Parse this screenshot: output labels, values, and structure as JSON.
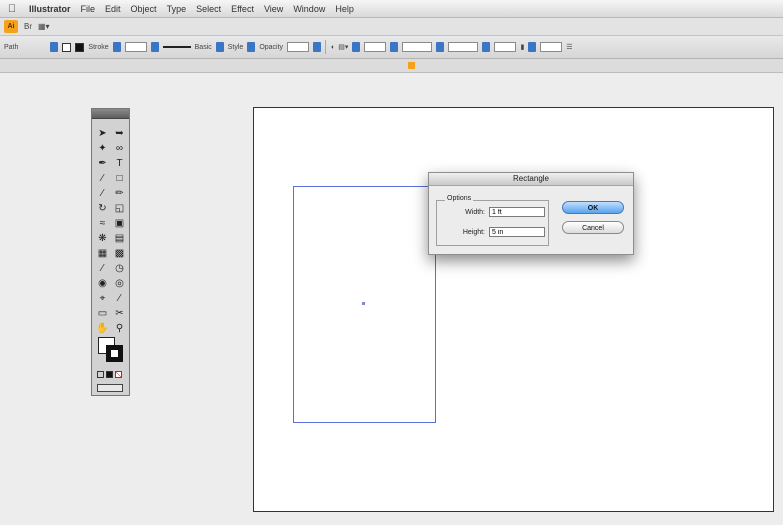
{
  "menubar": {
    "apple_icon": "apple-icon",
    "items": [
      "Illustrator",
      "File",
      "Edit",
      "Object",
      "Type",
      "Select",
      "Effect",
      "View",
      "Window",
      "Help"
    ]
  },
  "appbar": {
    "logo": "Ai"
  },
  "controlbar": {
    "path_label": "Path",
    "stroke_label": "Stroke",
    "basic_label": "Basic",
    "style_label": "Style",
    "opacity_label": "Opacity"
  },
  "document": {
    "zoom": "",
    "title": ""
  },
  "dialog": {
    "title": "Rectangle",
    "options_label": "Options",
    "width_label": "Width:",
    "width_value": "1 ft",
    "height_label": "Height:",
    "height_value": "5 in",
    "ok_label": "OK",
    "cancel_label": "Cancel"
  },
  "tools": [
    "selection-tool",
    "direct-selection-tool",
    "magic-wand-tool",
    "lasso-tool",
    "pen-tool",
    "type-tool",
    "line-tool",
    "rectangle-tool",
    "paintbrush-tool",
    "pencil-tool",
    "rotate-tool",
    "scale-tool",
    "warp-tool",
    "free-transform-tool",
    "symbol-sprayer-tool",
    "graph-tool",
    "mesh-tool",
    "gradient-tool",
    "eyedropper-tool",
    "blend-tool",
    "live-paint-tool",
    "live-paint-selection-tool",
    "crop-tool",
    "slice-tool",
    "eraser-tool",
    "scissors-tool",
    "hand-tool",
    "zoom-tool"
  ],
  "colors": {
    "selection_blue": "#5b6fd8",
    "ok_blue": "#5aa3ee",
    "ai_orange": "#f4a21c"
  }
}
